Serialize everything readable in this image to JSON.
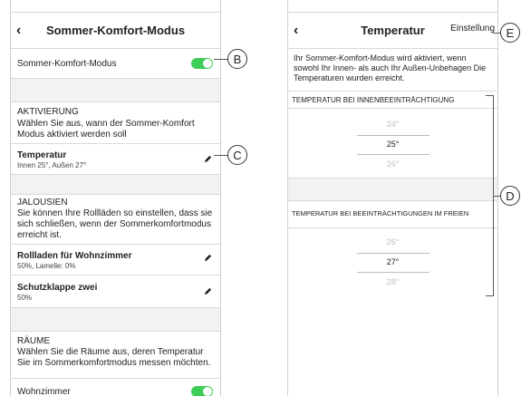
{
  "left_screen": {
    "header": {
      "title": "Sommer-Komfort-Modus"
    },
    "mode_toggle": {
      "label": "Sommer-Komfort-Modus",
      "on": true
    },
    "activation": {
      "title": "AKTIVIERUNG",
      "description": "Wählen Sie aus, wann der Sommer-Komfort Modus aktiviert werden soll"
    },
    "temperature_item": {
      "title": "Temperatur",
      "subtitle": "Innen 25°, Außen 27°"
    },
    "blinds": {
      "title": "JALOUSIEN",
      "description": "Sie können Ihre Rollläden so einstellen, dass sie sich schließen, wenn der Sommerkomfortmodus erreicht ist.",
      "items": [
        {
          "title": "Rollladen für Wohnzimmer",
          "subtitle": "50%, Lamelle: 0%"
        },
        {
          "title": "Schutzklappe zwei",
          "subtitle": "50%"
        }
      ]
    },
    "rooms": {
      "title": "RÄUME",
      "description": "Wählen Sie die Räume aus, deren Temperatur Sie im Sommerkomfortmodus messen möchten.",
      "items": [
        {
          "label": "Wohnzimmer",
          "on": true
        }
      ]
    }
  },
  "right_screen": {
    "header": {
      "title": "Temperatur",
      "action": "Einstellung"
    },
    "description": "Ihr Sommer-Komfort-Modus wird aktiviert, wenn sowohl Ihr Innen- als auch Ihr Außen-Unbehagen Die Temperaturen wurden erreicht.",
    "indoor": {
      "label": "TEMPERATUR BEI INNENBEEINTRÄCHTIGUNG",
      "options": [
        "24°",
        "25°",
        "26°"
      ],
      "selected_index": 1
    },
    "outdoor": {
      "label": "TEMPERATUR BEI BEEINTRÄCHTIGUNGEN IM FREIEN",
      "options": [
        "26°",
        "27°",
        "28°"
      ],
      "selected_index": 1
    }
  },
  "callouts": {
    "b": "B",
    "c": "C",
    "d": "D",
    "e": "E"
  },
  "colors": {
    "toggle_on": "#3dcd58",
    "band": "#f2f2f2",
    "divider": "#d9d9d9"
  },
  "icons": {
    "back": "chevron-left-icon",
    "edit": "pencil-icon"
  }
}
